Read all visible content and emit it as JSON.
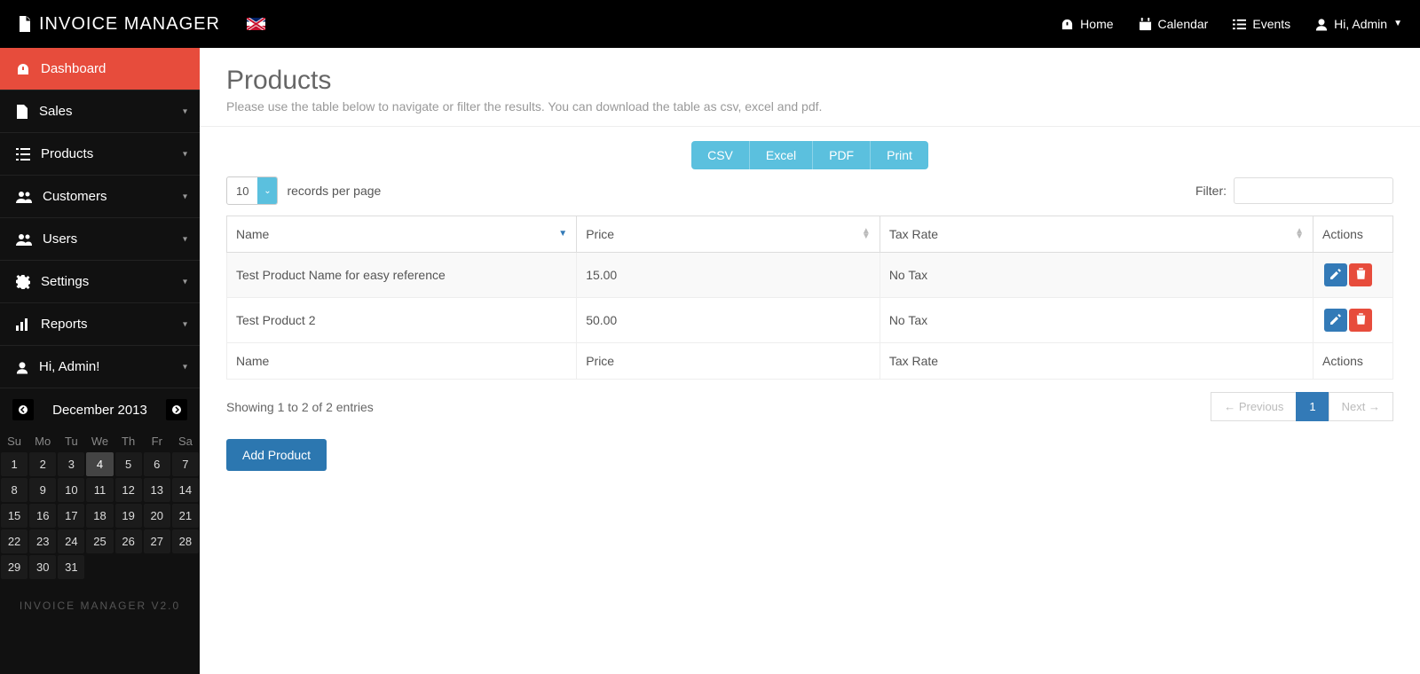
{
  "brand": "INVOICE MANAGER",
  "topnav": {
    "home": "Home",
    "calendar": "Calendar",
    "events": "Events",
    "user": "Hi, Admin"
  },
  "sidebar": {
    "items": [
      {
        "label": "Dashboard"
      },
      {
        "label": "Sales"
      },
      {
        "label": "Products"
      },
      {
        "label": "Customers"
      },
      {
        "label": "Users"
      },
      {
        "label": "Settings"
      },
      {
        "label": "Reports"
      },
      {
        "label": "Hi, Admin!"
      }
    ]
  },
  "calendar": {
    "title": "December 2013",
    "days_header": [
      "Su",
      "Mo",
      "Tu",
      "We",
      "Th",
      "Fr",
      "Sa"
    ],
    "weeks": [
      [
        "1",
        "2",
        "3",
        "4",
        "5",
        "6",
        "7"
      ],
      [
        "8",
        "9",
        "10",
        "11",
        "12",
        "13",
        "14"
      ],
      [
        "15",
        "16",
        "17",
        "18",
        "19",
        "20",
        "21"
      ],
      [
        "22",
        "23",
        "24",
        "25",
        "26",
        "27",
        "28"
      ],
      [
        "29",
        "30",
        "31",
        "",
        "",
        "",
        ""
      ]
    ],
    "highlight": "4"
  },
  "sidebar_footer": "INVOICE MANAGER V2.0",
  "page": {
    "title": "Products",
    "subtitle": "Please use the table below to navigate or filter the results. You can download the table as csv, excel and pdf."
  },
  "export": {
    "csv": "CSV",
    "excel": "Excel",
    "pdf": "PDF",
    "print": "Print"
  },
  "length": {
    "value": "10",
    "label": "records per page"
  },
  "filter": {
    "label": "Filter:",
    "value": ""
  },
  "table": {
    "headers": {
      "name": "Name",
      "price": "Price",
      "tax": "Tax Rate",
      "actions": "Actions"
    },
    "rows": [
      {
        "name": "Test Product Name for easy reference",
        "price": "15.00",
        "tax": "No Tax"
      },
      {
        "name": "Test Product 2",
        "price": "50.00",
        "tax": "No Tax"
      }
    ],
    "footers": {
      "name": "Name",
      "price": "Price",
      "tax": "Tax Rate",
      "actions": "Actions"
    }
  },
  "info_text": "Showing 1 to 2 of 2 entries",
  "pagination": {
    "prev": "← Previous",
    "pages": [
      "1"
    ],
    "next": "Next →"
  },
  "add_button": "Add Product"
}
